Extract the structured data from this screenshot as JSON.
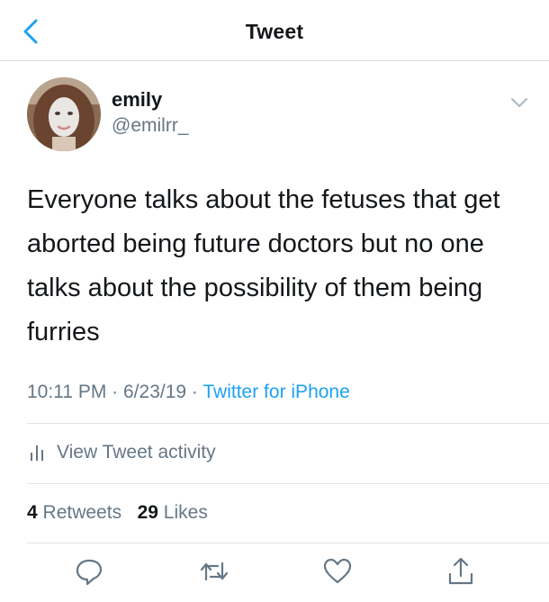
{
  "nav": {
    "title": "Tweet",
    "back_icon": "chevron-left-icon"
  },
  "author": {
    "display_name": "emily",
    "handle": "@emilrr_"
  },
  "tweet": {
    "text": "Everyone talks about the fetuses that get aborted being future doctors but no one talks about the possibility of them being furries",
    "time": "10:11 PM",
    "separator": " · ",
    "date": "6/23/19",
    "source": "Twitter for iPhone"
  },
  "activity": {
    "label": "View Tweet activity",
    "icon": "bar-chart-icon"
  },
  "stats": {
    "retweets_count": "4",
    "retweets_label": "Retweets",
    "likes_count": "29",
    "likes_label": "Likes"
  },
  "actions": [
    "reply-icon",
    "retweet-icon",
    "like-icon",
    "share-icon"
  ],
  "colors": {
    "accent": "#1da1f2",
    "text_primary": "#14171a",
    "text_secondary": "#657786",
    "divider": "#e1e5e8"
  }
}
